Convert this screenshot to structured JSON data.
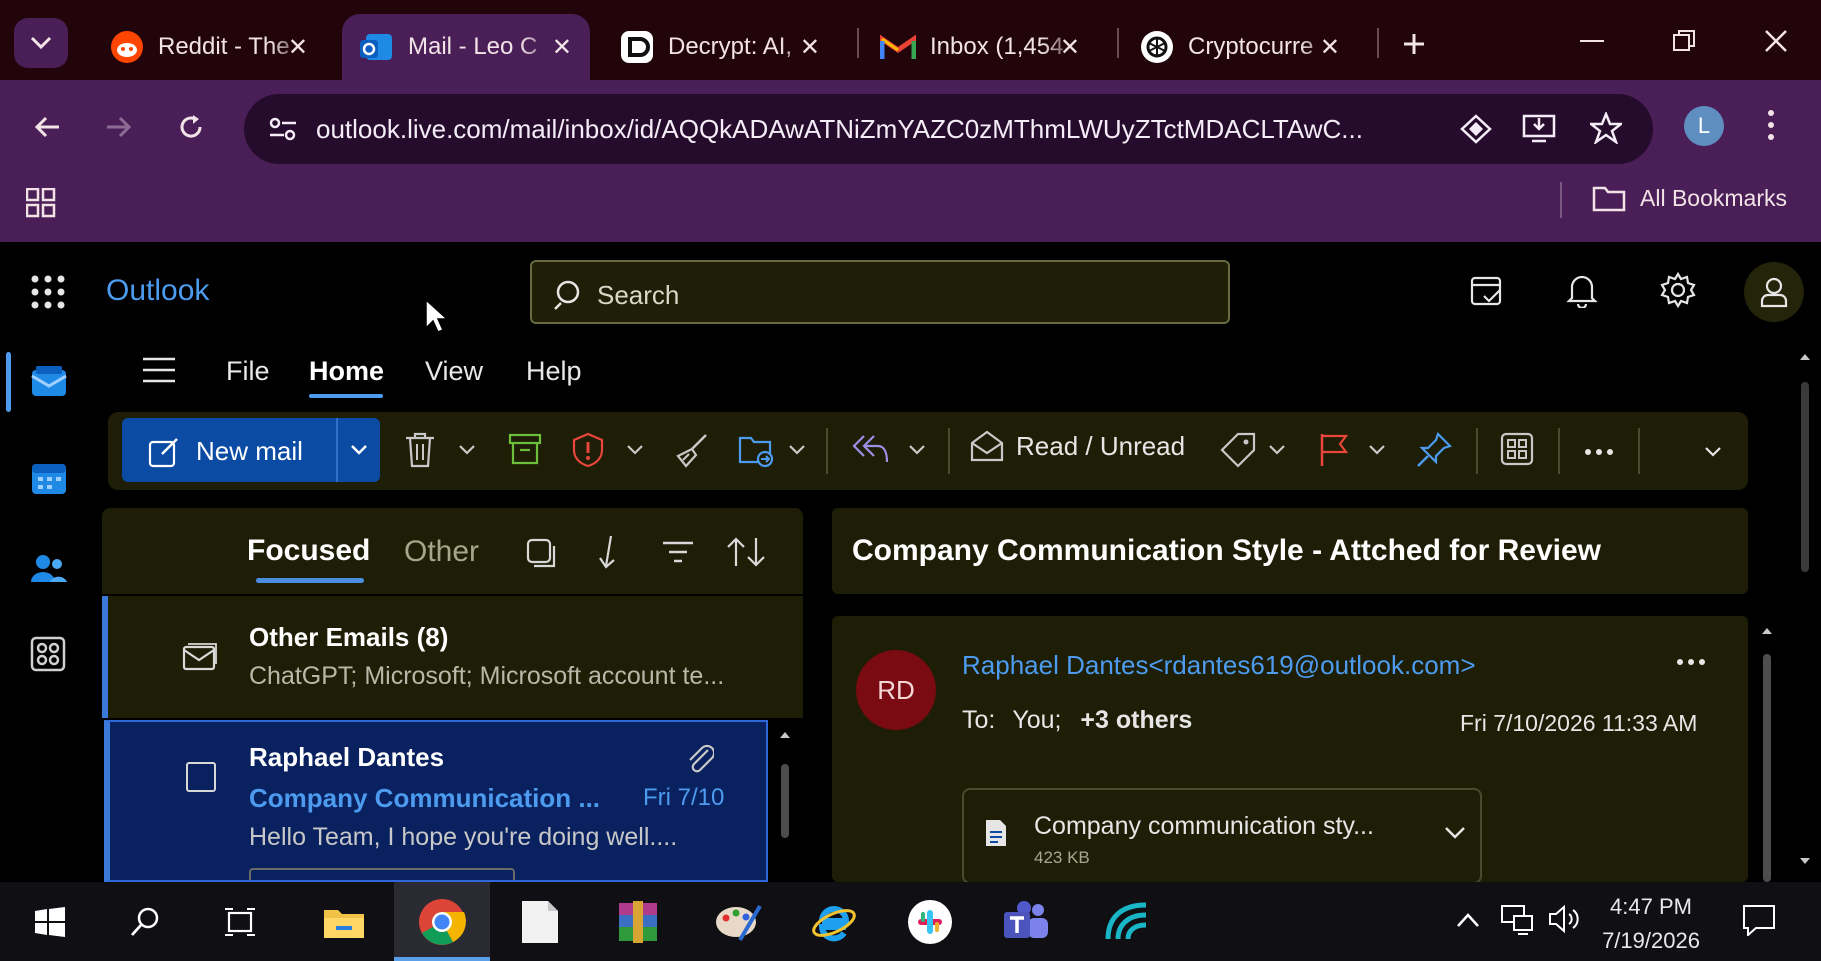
{
  "browser": {
    "tabs": [
      {
        "title": "Reddit - The",
        "icon": "reddit-icon",
        "active": false
      },
      {
        "title": "Mail - Leo C",
        "icon": "outlook-icon",
        "active": true
      },
      {
        "title": "Decrypt: AI,",
        "icon": "decrypt-icon",
        "active": false
      },
      {
        "title": "Inbox (1,454",
        "icon": "gmail-icon",
        "active": false
      },
      {
        "title": "Cryptocurre",
        "icon": "chatgpt-icon",
        "active": false
      }
    ],
    "address": "outlook.live.com/mail/inbox/id/AQQkADAwATNiZmYAZC0zMThmLWUyZTctMDACLTAwC...",
    "profile_initial": "L",
    "bookmarks_label": "All Bookmarks"
  },
  "outlook": {
    "brand": "Outlook",
    "search_placeholder": "Search",
    "menu_tabs": [
      "File",
      "Home",
      "View",
      "Help"
    ],
    "active_menu": "Home",
    "ribbon": {
      "new_mail": "New mail",
      "read_unread": "Read / Unread"
    },
    "list": {
      "focused": "Focused",
      "other": "Other",
      "other_emails_title": "Other Emails (8)",
      "other_emails_preview": "ChatGPT; Microsoft; Microsoft account te...",
      "selected": {
        "sender": "Raphael Dantes",
        "subject": "Company Communication ...",
        "date": "Fri 7/10",
        "preview": "Hello Team, I hope you're doing well...."
      }
    },
    "reading": {
      "subject": "Company Communication Style - Attched for Review",
      "avatar_initials": "RD",
      "from": "Raphael Dantes<rdantes619@outlook.com>",
      "to_label": "To:",
      "to_you": "You;",
      "to_others": "+3 others",
      "date": "Fri 7/10/2026 11:33 AM",
      "attachment_name": "Company communication sty...",
      "attachment_size": "423 KB"
    }
  },
  "taskbar": {
    "time": "4:47 PM",
    "date": "7/19/2026"
  },
  "colors": {
    "accent_blue": "#0b4ba3",
    "link_blue": "#4c9bef",
    "browser_purple": "#4a1f57",
    "avatar_red": "#7a0b12"
  }
}
